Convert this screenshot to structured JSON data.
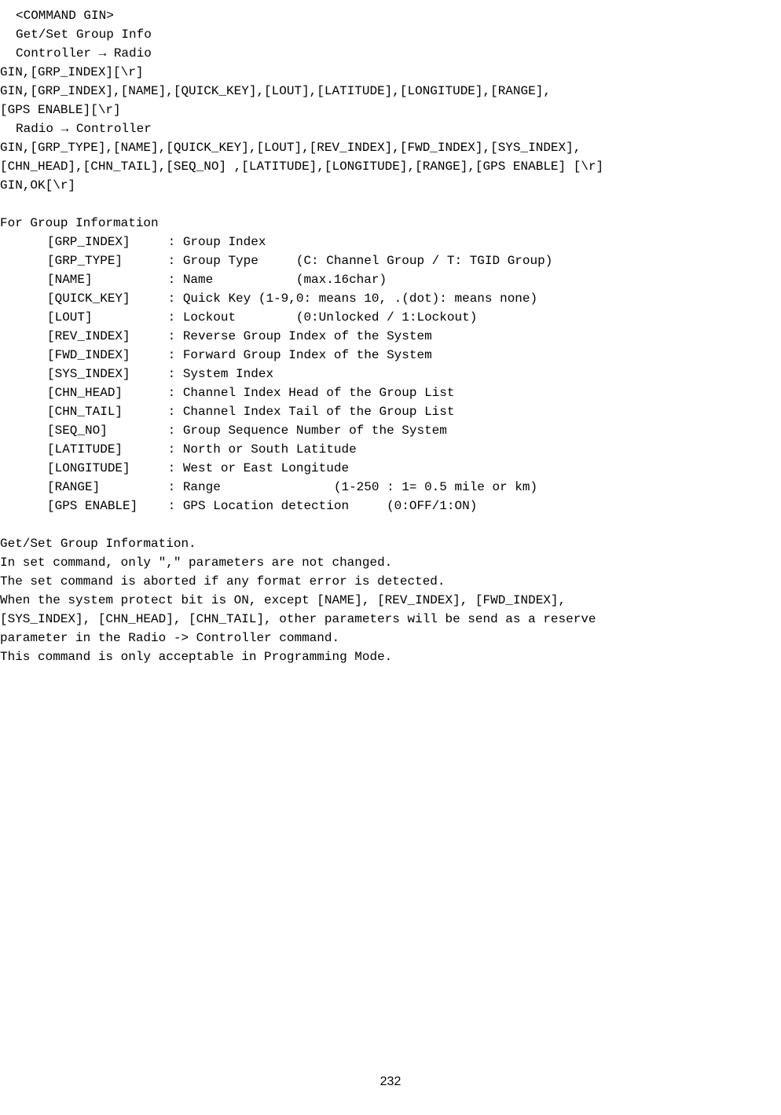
{
  "header": {
    "command_tag": "<COMMAND GIN>",
    "title": "Get/Set Group Info",
    "direction_ctrl_radio": "Controller → Radio",
    "ctrl_radio_line1": "GIN,[GRP_INDEX][\\r]",
    "ctrl_radio_line2": "GIN,[GRP_INDEX],[NAME],[QUICK_KEY],[LOUT],[LATITUDE],[LONGITUDE],[RANGE],",
    "ctrl_radio_line3": "[GPS ENABLE][\\r]",
    "direction_radio_ctrl": "Radio → Controller",
    "radio_ctrl_line1": "GIN,[GRP_TYPE],[NAME],[QUICK_KEY],[LOUT],[REV_INDEX],[FWD_INDEX],[SYS_INDEX],",
    "radio_ctrl_line2": "[CHN_HEAD],[CHN_TAIL],[SEQ_NO] ,[LATITUDE],[LONGITUDE],[RANGE],[GPS ENABLE] [\\r]",
    "radio_ctrl_line3": "GIN,OK[\\r]"
  },
  "info_header": "For Group Information",
  "params": [
    {
      "name": "[GRP_INDEX]",
      "desc": ": Group Index"
    },
    {
      "name": "[GRP_TYPE]",
      "desc": ": Group Type     (C: Channel Group / T: TGID Group)"
    },
    {
      "name": "[NAME]",
      "desc": ": Name           (max.16char)"
    },
    {
      "name": "[QUICK_KEY]",
      "desc": ": Quick Key (1-9,0: means 10, .(dot): means none)"
    },
    {
      "name": "[LOUT]",
      "desc": ": Lockout        (0:Unlocked / 1:Lockout)"
    },
    {
      "name": "[REV_INDEX]",
      "desc": ": Reverse Group Index of the System"
    },
    {
      "name": "[FWD_INDEX]",
      "desc": ": Forward Group Index of the System"
    },
    {
      "name": "[SYS_INDEX]",
      "desc": ": System Index"
    },
    {
      "name": "[CHN_HEAD]",
      "desc": ": Channel Index Head of the Group List"
    },
    {
      "name": "[CHN_TAIL]",
      "desc": ": Channel Index Tail of the Group List"
    },
    {
      "name": "[SEQ_NO]",
      "desc": ": Group Sequence Number of the System"
    },
    {
      "name": "[LATITUDE]",
      "desc": ": North or South Latitude"
    },
    {
      "name": "[LONGITUDE]",
      "desc": ": West or East Longitude"
    },
    {
      "name": "[RANGE]",
      "desc": ": Range               (1-250 : 1= 0.5 mile or km)"
    },
    {
      "name": "[GPS ENABLE]",
      "desc": ": GPS Location detection     (0:OFF/1:ON)"
    }
  ],
  "notes": {
    "line1": "Get/Set Group Information.",
    "line2": "In set command, only \",\" parameters are not changed.",
    "line3": "The set command is aborted if any format error is detected.",
    "line4": "When the system protect bit is ON, except [NAME], [REV_INDEX], [FWD_INDEX],",
    "line5": "[SYS_INDEX], [CHN_HEAD], [CHN_TAIL], other parameters will be send as a reserve",
    "line6": "parameter in the Radio -> Controller command.",
    "line7": "This command is only acceptable in Programming Mode."
  },
  "page_number": "232"
}
